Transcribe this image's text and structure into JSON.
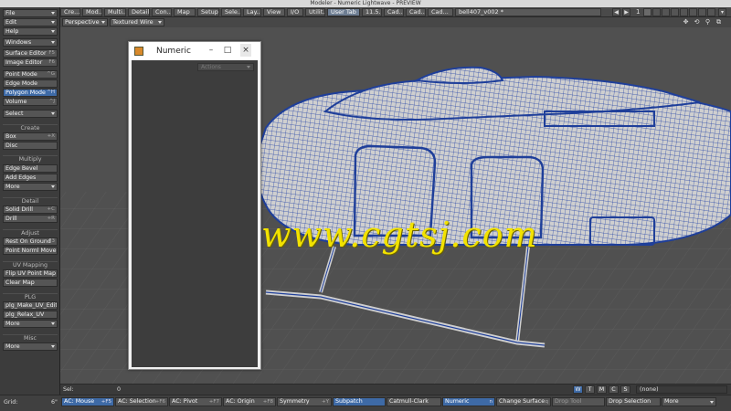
{
  "window": {
    "title": "Modeler - Numeric Lightwave - PREVIEW"
  },
  "tabs": [
    {
      "label": "Cre..."
    },
    {
      "label": "Mod..."
    },
    {
      "label": "Multi..."
    },
    {
      "label": "Detail"
    },
    {
      "label": "Con..."
    },
    {
      "label": "Map"
    },
    {
      "label": "Setup"
    },
    {
      "label": "Sele..."
    },
    {
      "label": "Lay..."
    },
    {
      "label": "View"
    },
    {
      "label": "I/O"
    },
    {
      "label": "Utilit..."
    },
    {
      "label": "User Tab"
    },
    {
      "label": "11.5..."
    },
    {
      "label": "Cad..."
    },
    {
      "label": "Cad..."
    },
    {
      "label": "Cad..."
    },
    {
      "label": "bell407_v002 *"
    }
  ],
  "top_right": {
    "layer_num": "1"
  },
  "sidebar": {
    "file": "File",
    "edit": "Edit",
    "help": "Help",
    "windows": "Windows",
    "surface_editor": {
      "label": "Surface Editor",
      "sc": "F5"
    },
    "image_editor": {
      "label": "Image Editor",
      "sc": "F6"
    },
    "point_mode": {
      "label": "Point Mode",
      "sc": "^G"
    },
    "edge_mode": {
      "label": "Edge Mode",
      "sc": ""
    },
    "polygon_mode": {
      "label": "Polygon Mode",
      "sc": "^H"
    },
    "volume": {
      "label": "Volume",
      "sc": "^J"
    },
    "select": "Select",
    "create_head": "Create",
    "box": {
      "label": "Box",
      "sc": "+X"
    },
    "disc": {
      "label": "Disc",
      "sc": ""
    },
    "multiply_head": "Multiply",
    "edge_bevel": "Edge Bevel",
    "add_edges": "Add Edges",
    "more1": "More",
    "detail_head": "Detail",
    "solid_drill": {
      "label": "Solid Drill",
      "sc": "+C"
    },
    "drill": {
      "label": "Drill",
      "sc": "+R"
    },
    "adjust_head": "Adjust",
    "rest_on_ground": {
      "label": "Rest On Ground",
      "sc": "F3"
    },
    "point_norml_move": "Point Norml Move",
    "uv_head": "UV Mapping",
    "flip_uv": "Flip UV Point Map",
    "clear_map": "Clear Map",
    "plg_head": "PLG",
    "plg_make": "plg_Make_UV_Edit",
    "plg_relax": "plg_Relax_UV",
    "more2": "More",
    "misc_head": "Misc",
    "more3": "More"
  },
  "viewport_bar": {
    "view": "Perspective",
    "shading": "Textured Wire"
  },
  "watermark": "www.cgtsj.com",
  "numeric_window": {
    "title": "Numeric",
    "minimize": "–",
    "maximize": "□",
    "close": "×",
    "actions": "Actions"
  },
  "status_bar": {
    "sel_label": "Sel:",
    "sel_value": "0",
    "wtmcs": [
      "W",
      "T",
      "M",
      "C",
      "S"
    ],
    "surface": "(none)"
  },
  "bottom_bar": {
    "grid_label": "Grid:",
    "grid_value": "6\"",
    "ac_mouse": {
      "label": "AC: Mouse",
      "sc": "+F5"
    },
    "ac_selection": {
      "label": "AC: Selection",
      "sc": "+F6"
    },
    "ac_pivot": {
      "label": "AC: Pivot",
      "sc": "+F7"
    },
    "ac_origin": {
      "label": "AC: Origin",
      "sc": "+F8"
    },
    "symmetry": {
      "label": "Symmetry",
      "sc": "+Y"
    },
    "subpatch": "Subpatch",
    "catmull_clark": "Catmull-Clark",
    "numeric": {
      "label": "Numeric",
      "sc": "n"
    },
    "change_surface": {
      "label": "Change Surface",
      "sc": "q"
    },
    "drop_tool": "Drop Tool",
    "drop_selection": "Drop Selection",
    "more": "More"
  },
  "colors": {
    "wire": "#1f3f9a",
    "mesh_fill": "#c9c9c9",
    "grid": "#6a6a6a",
    "viewport_bg": "#505050",
    "selected": "#3e6aa6",
    "watermark": "#f2e200"
  }
}
